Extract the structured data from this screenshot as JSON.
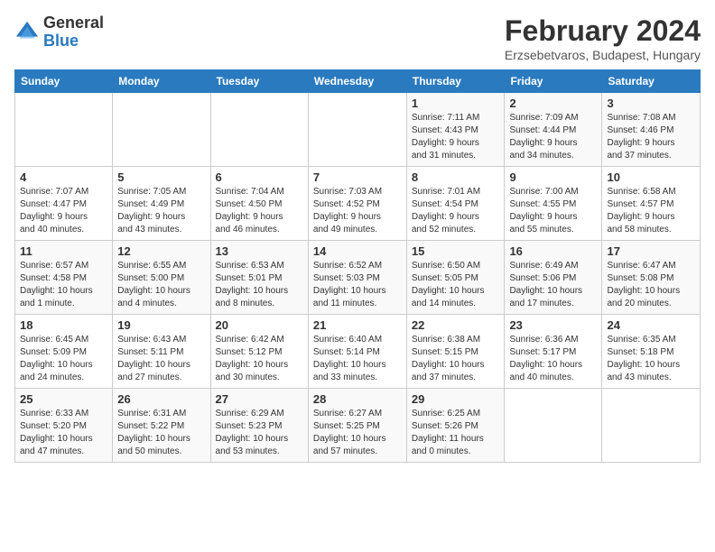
{
  "header": {
    "logo_general": "General",
    "logo_blue": "Blue",
    "title": "February 2024",
    "subtitle": "Erzsebetvaros, Budapest, Hungary"
  },
  "columns": [
    "Sunday",
    "Monday",
    "Tuesday",
    "Wednesday",
    "Thursday",
    "Friday",
    "Saturday"
  ],
  "weeks": [
    {
      "days": [
        {
          "number": "",
          "detail": ""
        },
        {
          "number": "",
          "detail": ""
        },
        {
          "number": "",
          "detail": ""
        },
        {
          "number": "",
          "detail": ""
        },
        {
          "number": "1",
          "detail": "Sunrise: 7:11 AM\nSunset: 4:43 PM\nDaylight: 9 hours\nand 31 minutes."
        },
        {
          "number": "2",
          "detail": "Sunrise: 7:09 AM\nSunset: 4:44 PM\nDaylight: 9 hours\nand 34 minutes."
        },
        {
          "number": "3",
          "detail": "Sunrise: 7:08 AM\nSunset: 4:46 PM\nDaylight: 9 hours\nand 37 minutes."
        }
      ]
    },
    {
      "days": [
        {
          "number": "4",
          "detail": "Sunrise: 7:07 AM\nSunset: 4:47 PM\nDaylight: 9 hours\nand 40 minutes."
        },
        {
          "number": "5",
          "detail": "Sunrise: 7:05 AM\nSunset: 4:49 PM\nDaylight: 9 hours\nand 43 minutes."
        },
        {
          "number": "6",
          "detail": "Sunrise: 7:04 AM\nSunset: 4:50 PM\nDaylight: 9 hours\nand 46 minutes."
        },
        {
          "number": "7",
          "detail": "Sunrise: 7:03 AM\nSunset: 4:52 PM\nDaylight: 9 hours\nand 49 minutes."
        },
        {
          "number": "8",
          "detail": "Sunrise: 7:01 AM\nSunset: 4:54 PM\nDaylight: 9 hours\nand 52 minutes."
        },
        {
          "number": "9",
          "detail": "Sunrise: 7:00 AM\nSunset: 4:55 PM\nDaylight: 9 hours\nand 55 minutes."
        },
        {
          "number": "10",
          "detail": "Sunrise: 6:58 AM\nSunset: 4:57 PM\nDaylight: 9 hours\nand 58 minutes."
        }
      ]
    },
    {
      "days": [
        {
          "number": "11",
          "detail": "Sunrise: 6:57 AM\nSunset: 4:58 PM\nDaylight: 10 hours\nand 1 minute."
        },
        {
          "number": "12",
          "detail": "Sunrise: 6:55 AM\nSunset: 5:00 PM\nDaylight: 10 hours\nand 4 minutes."
        },
        {
          "number": "13",
          "detail": "Sunrise: 6:53 AM\nSunset: 5:01 PM\nDaylight: 10 hours\nand 8 minutes."
        },
        {
          "number": "14",
          "detail": "Sunrise: 6:52 AM\nSunset: 5:03 PM\nDaylight: 10 hours\nand 11 minutes."
        },
        {
          "number": "15",
          "detail": "Sunrise: 6:50 AM\nSunset: 5:05 PM\nDaylight: 10 hours\nand 14 minutes."
        },
        {
          "number": "16",
          "detail": "Sunrise: 6:49 AM\nSunset: 5:06 PM\nDaylight: 10 hours\nand 17 minutes."
        },
        {
          "number": "17",
          "detail": "Sunrise: 6:47 AM\nSunset: 5:08 PM\nDaylight: 10 hours\nand 20 minutes."
        }
      ]
    },
    {
      "days": [
        {
          "number": "18",
          "detail": "Sunrise: 6:45 AM\nSunset: 5:09 PM\nDaylight: 10 hours\nand 24 minutes."
        },
        {
          "number": "19",
          "detail": "Sunrise: 6:43 AM\nSunset: 5:11 PM\nDaylight: 10 hours\nand 27 minutes."
        },
        {
          "number": "20",
          "detail": "Sunrise: 6:42 AM\nSunset: 5:12 PM\nDaylight: 10 hours\nand 30 minutes."
        },
        {
          "number": "21",
          "detail": "Sunrise: 6:40 AM\nSunset: 5:14 PM\nDaylight: 10 hours\nand 33 minutes."
        },
        {
          "number": "22",
          "detail": "Sunrise: 6:38 AM\nSunset: 5:15 PM\nDaylight: 10 hours\nand 37 minutes."
        },
        {
          "number": "23",
          "detail": "Sunrise: 6:36 AM\nSunset: 5:17 PM\nDaylight: 10 hours\nand 40 minutes."
        },
        {
          "number": "24",
          "detail": "Sunrise: 6:35 AM\nSunset: 5:18 PM\nDaylight: 10 hours\nand 43 minutes."
        }
      ]
    },
    {
      "days": [
        {
          "number": "25",
          "detail": "Sunrise: 6:33 AM\nSunset: 5:20 PM\nDaylight: 10 hours\nand 47 minutes."
        },
        {
          "number": "26",
          "detail": "Sunrise: 6:31 AM\nSunset: 5:22 PM\nDaylight: 10 hours\nand 50 minutes."
        },
        {
          "number": "27",
          "detail": "Sunrise: 6:29 AM\nSunset: 5:23 PM\nDaylight: 10 hours\nand 53 minutes."
        },
        {
          "number": "28",
          "detail": "Sunrise: 6:27 AM\nSunset: 5:25 PM\nDaylight: 10 hours\nand 57 minutes."
        },
        {
          "number": "29",
          "detail": "Sunrise: 6:25 AM\nSunset: 5:26 PM\nDaylight: 11 hours\nand 0 minutes."
        },
        {
          "number": "",
          "detail": ""
        },
        {
          "number": "",
          "detail": ""
        }
      ]
    }
  ]
}
